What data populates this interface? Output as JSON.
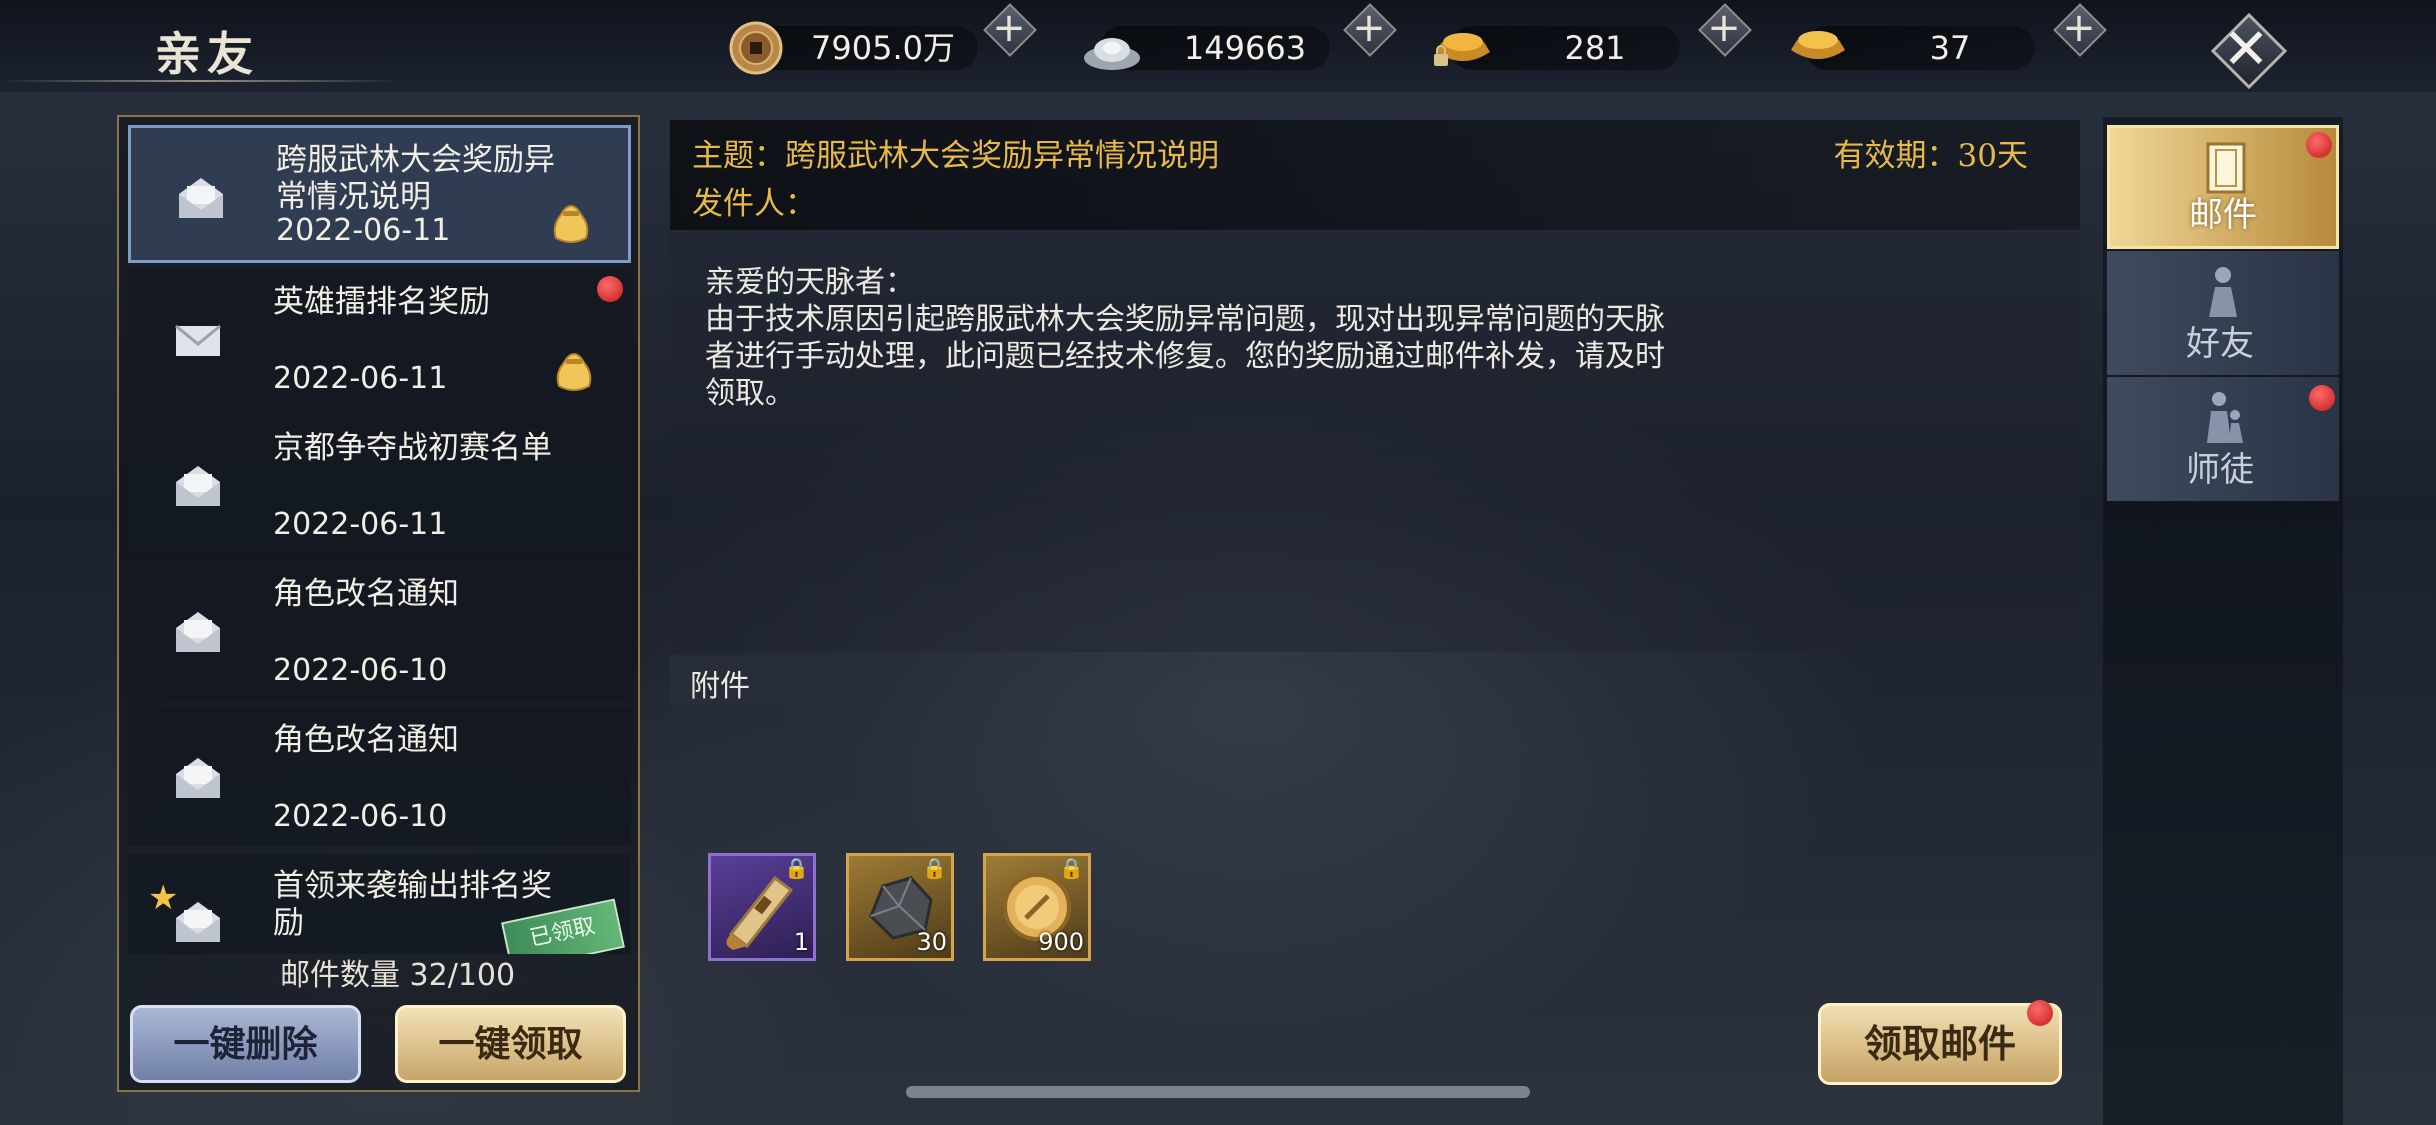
{
  "header": {
    "title": "亲友",
    "currencies": [
      {
        "icon": "copper-coin-icon",
        "value": "7905.0万"
      },
      {
        "icon": "silver-ingot-icon",
        "value": "149663"
      },
      {
        "icon": "locked-gold-ingot-icon",
        "value": "281"
      },
      {
        "icon": "gold-ingot-icon",
        "value": "37"
      }
    ],
    "plus_label": "+",
    "close_label": "✕"
  },
  "mail_list": {
    "items": [
      {
        "title": "跨服武林大会奖励异常情况说明",
        "date": "2022-06-11",
        "read": true,
        "has_reward": true,
        "unread_dot": false,
        "selected": true
      },
      {
        "title": "英雄擂排名奖励",
        "date": "2022-06-11",
        "read": false,
        "has_reward": true,
        "unread_dot": true,
        "selected": false
      },
      {
        "title": "京都争夺战初赛名单",
        "date": "2022-06-11",
        "read": true,
        "has_reward": false,
        "unread_dot": false,
        "selected": false
      },
      {
        "title": "角色改名通知",
        "date": "2022-06-10",
        "read": true,
        "has_reward": false,
        "unread_dot": false,
        "selected": false
      },
      {
        "title": "角色改名通知",
        "date": "2022-06-10",
        "read": true,
        "has_reward": false,
        "unread_dot": false,
        "selected": false
      },
      {
        "title": "首领来袭输出排名奖励",
        "date": "",
        "read": true,
        "starred": true,
        "claimed_stamp": "已领取",
        "selected": false
      }
    ],
    "count_label": "邮件数量 32/100",
    "delete_all_label": "一键删除",
    "claim_all_label": "一键领取"
  },
  "detail": {
    "subject": "主题：跨服武林大会奖励异常情况说明",
    "validity": "有效期：30天",
    "sender": "发件人：",
    "body": "亲爱的天脉者：\n由于技术原因引起跨服武林大会奖励异常问题，现对出现异常问题的天脉\n者进行手动处理，此问题已经技术修复。您的奖励通过邮件补发，请及时\n领取。",
    "attachments_label": "附件",
    "attachments": [
      {
        "icon": "scroll-horn-icon",
        "qty": "1",
        "rarity": "purple",
        "locked": true
      },
      {
        "icon": "ore-stone-icon",
        "qty": "30",
        "rarity": "gold",
        "locked": true
      },
      {
        "icon": "gold-token-icon",
        "qty": "900",
        "rarity": "gold",
        "locked": true
      }
    ],
    "claim_button_label": "领取邮件"
  },
  "tabs": [
    {
      "label": "邮件",
      "icon": "mail-book-icon",
      "active": true,
      "dot": true
    },
    {
      "label": "好友",
      "icon": "friend-figure-icon",
      "active": false,
      "dot": false
    },
    {
      "label": "师徒",
      "icon": "master-apprentice-icon",
      "active": false,
      "dot": true
    }
  ],
  "colors": {
    "accent_gold": "#e6b94a",
    "unread_red": "#d62222",
    "selected_border": "#7f9cc4"
  }
}
